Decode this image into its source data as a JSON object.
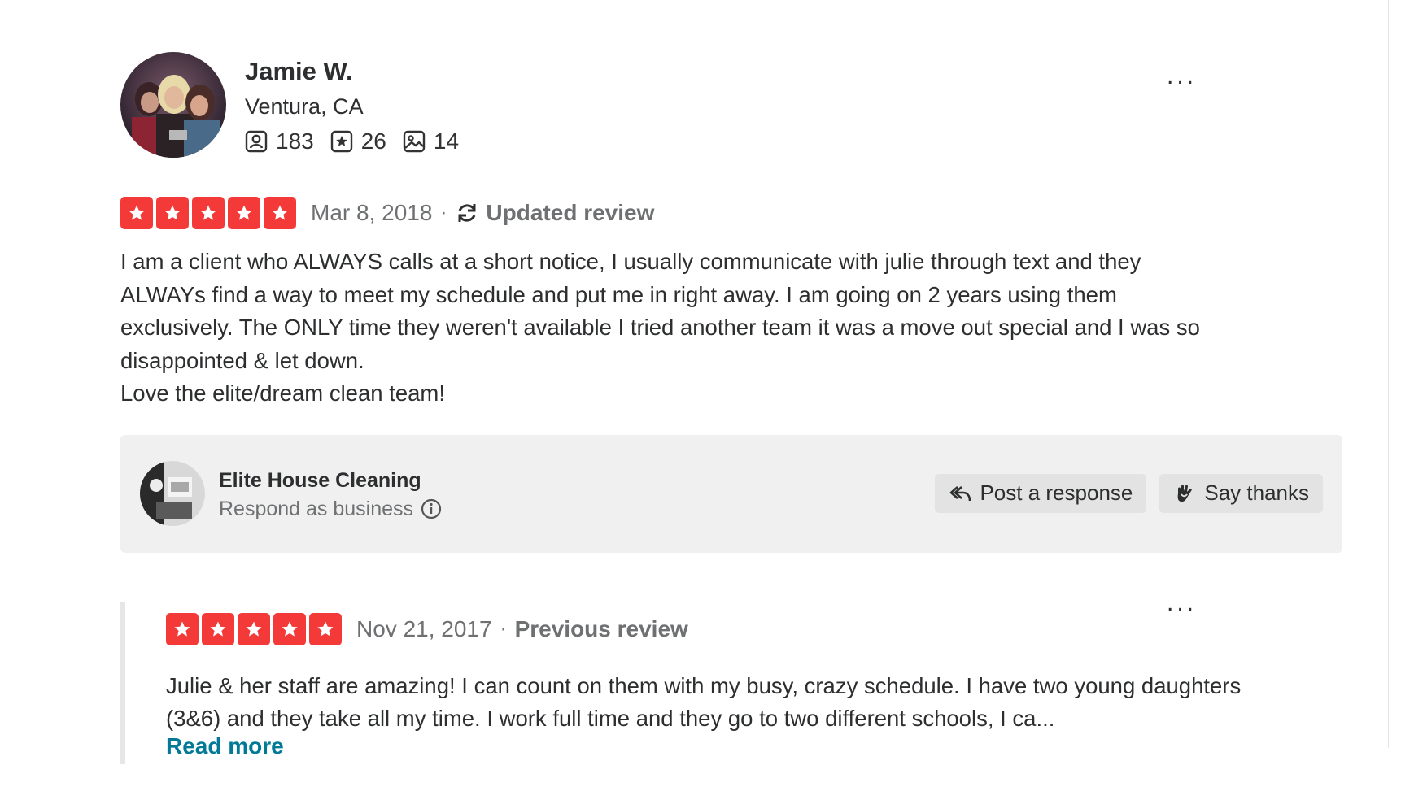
{
  "user": {
    "name": "Jamie W.",
    "location": "Ventura, CA",
    "stats": {
      "friends": "183",
      "reviews": "26",
      "photos": "14"
    }
  },
  "current_review": {
    "rating": 5,
    "date": "Mar 8, 2018",
    "separator": "·",
    "status": "Updated review",
    "text": "I am a client who ALWAYS calls at a short notice, I usually communicate with julie through text and they ALWAYs find a way to meet my schedule and put me in right away. I am going on 2 years using them exclusively. The ONLY time they weren't available I tried another team it was a move out special and I was so disappointed & let down.\nLove the elite/dream clean team!"
  },
  "business": {
    "name": "Elite House Cleaning",
    "subtitle": "Respond as business",
    "post_response_label": "Post a response",
    "say_thanks_label": "Say thanks"
  },
  "previous_review": {
    "rating": 5,
    "date": "Nov 21, 2017",
    "separator": "·",
    "status": "Previous review",
    "text": "Julie & her staff are amazing! I can count on them with my busy, crazy schedule. I have two young daughters (3&6) and they take all my time. I work full time and they go to two different schools, I ca...",
    "read_more_label": "Read more"
  },
  "menu_label": "...",
  "colors": {
    "star_red": "#f43939",
    "link_teal": "#027a97",
    "muted_gray": "#6e7072",
    "panel_gray": "#f0f0f0"
  },
  "icons": [
    "friends-icon",
    "review-star-icon",
    "photo-icon",
    "refresh-icon",
    "reply-icon",
    "thanks-icon",
    "info-icon",
    "star-icon",
    "more-options-icon"
  ]
}
